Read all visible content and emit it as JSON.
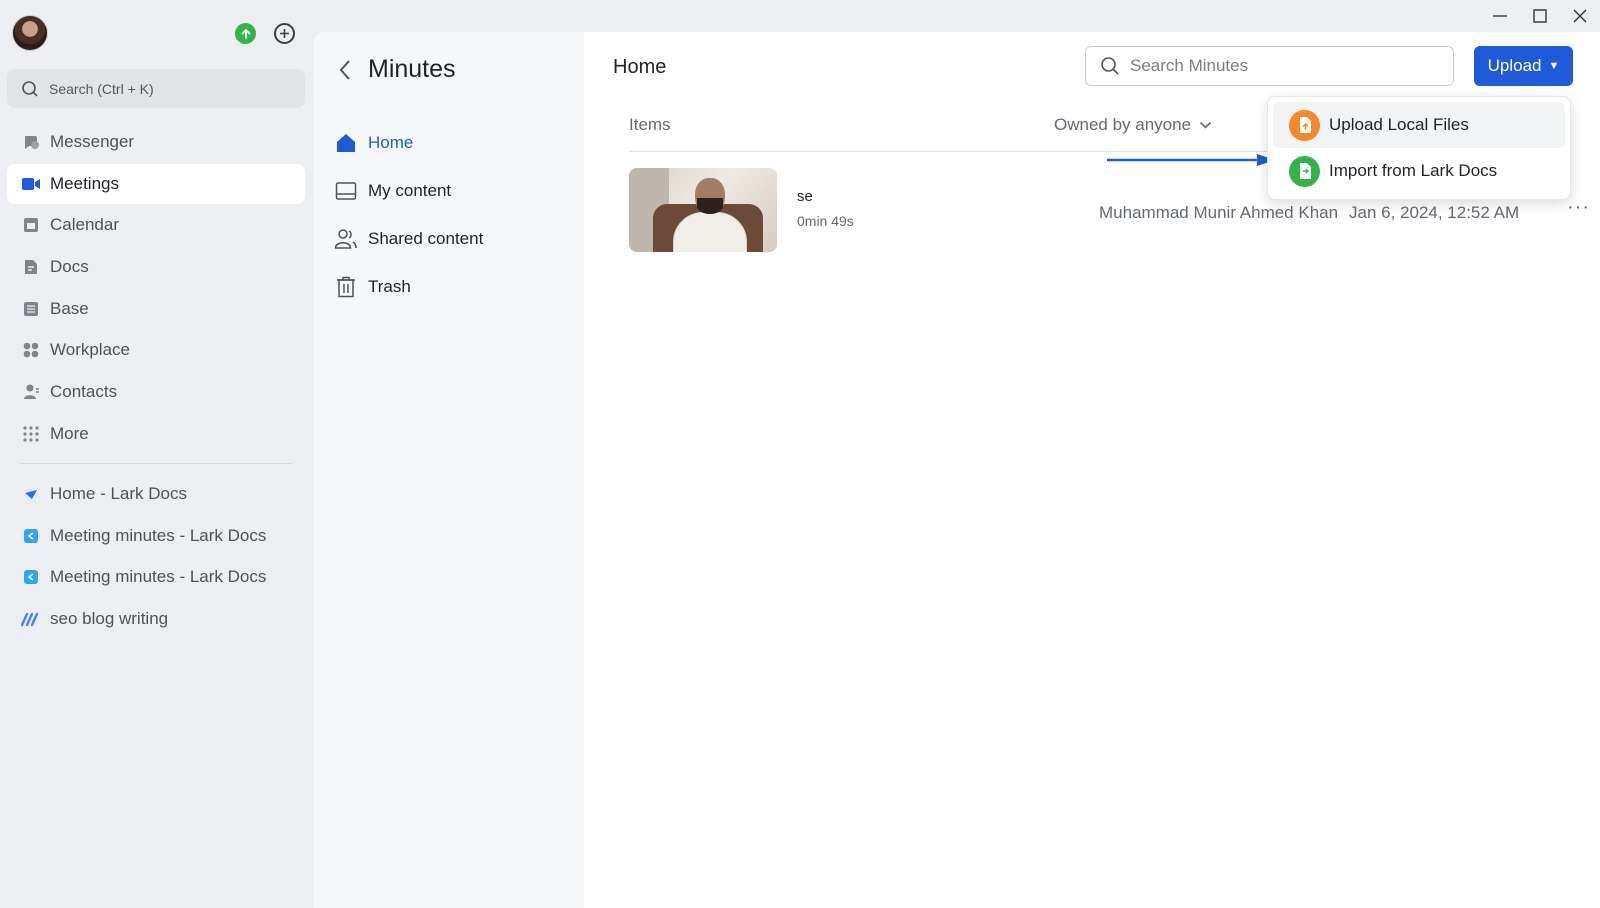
{
  "window": {
    "controls": [
      "minimize",
      "maximize",
      "close"
    ]
  },
  "sidebar": {
    "search_placeholder": "Search (Ctrl + K)",
    "nav": [
      {
        "label": "Messenger",
        "icon": "messenger-icon",
        "active": false
      },
      {
        "label": "Meetings",
        "icon": "video-camera-icon",
        "active": true
      },
      {
        "label": "Calendar",
        "icon": "calendar-icon",
        "active": false
      },
      {
        "label": "Docs",
        "icon": "docs-icon",
        "active": false
      },
      {
        "label": "Base",
        "icon": "base-icon",
        "active": false
      },
      {
        "label": "Workplace",
        "icon": "workplace-icon",
        "active": false
      },
      {
        "label": "Contacts",
        "icon": "contacts-icon",
        "active": false
      },
      {
        "label": "More",
        "icon": "more-dots-icon",
        "active": false
      }
    ],
    "pinned": [
      {
        "label": "Home - Lark Docs",
        "icon": "lark-docs-home-icon"
      },
      {
        "label": "Meeting minutes - Lark Docs",
        "icon": "lark-doc-icon"
      },
      {
        "label": "Meeting minutes - Lark Docs",
        "icon": "lark-doc-icon"
      },
      {
        "label": "seo blog writing",
        "icon": "whiteboard-icon"
      }
    ]
  },
  "minutes_panel": {
    "title": "Minutes",
    "nav": [
      {
        "label": "Home",
        "icon": "home-icon",
        "active": true
      },
      {
        "label": "My content",
        "icon": "folder-icon",
        "active": false
      },
      {
        "label": "Shared content",
        "icon": "shared-users-icon",
        "active": false
      },
      {
        "label": "Trash",
        "icon": "trash-icon",
        "active": false
      }
    ]
  },
  "main": {
    "title": "Home",
    "search_placeholder": "Search Minutes",
    "upload_label": "Upload",
    "columns": {
      "items": "Items",
      "owner_filter": "Owned by anyone"
    },
    "rows": [
      {
        "title": "se",
        "duration": "0min 49s",
        "owner": "Muhammad Munir Ahmed Khan",
        "date": "Jan 6, 2024, 12:52 AM",
        "more": "···"
      }
    ]
  },
  "upload_menu": {
    "items": [
      {
        "label": "Upload Local Files",
        "icon": "upload-file-icon",
        "color": "#f5882b"
      },
      {
        "label": "Import from Lark Docs",
        "icon": "import-doc-icon",
        "color": "#34b34a"
      }
    ]
  },
  "colors": {
    "accent": "#1f5bd8",
    "sidebar_bg": "#eceef1",
    "panel_bg": "#f6f7f8"
  }
}
